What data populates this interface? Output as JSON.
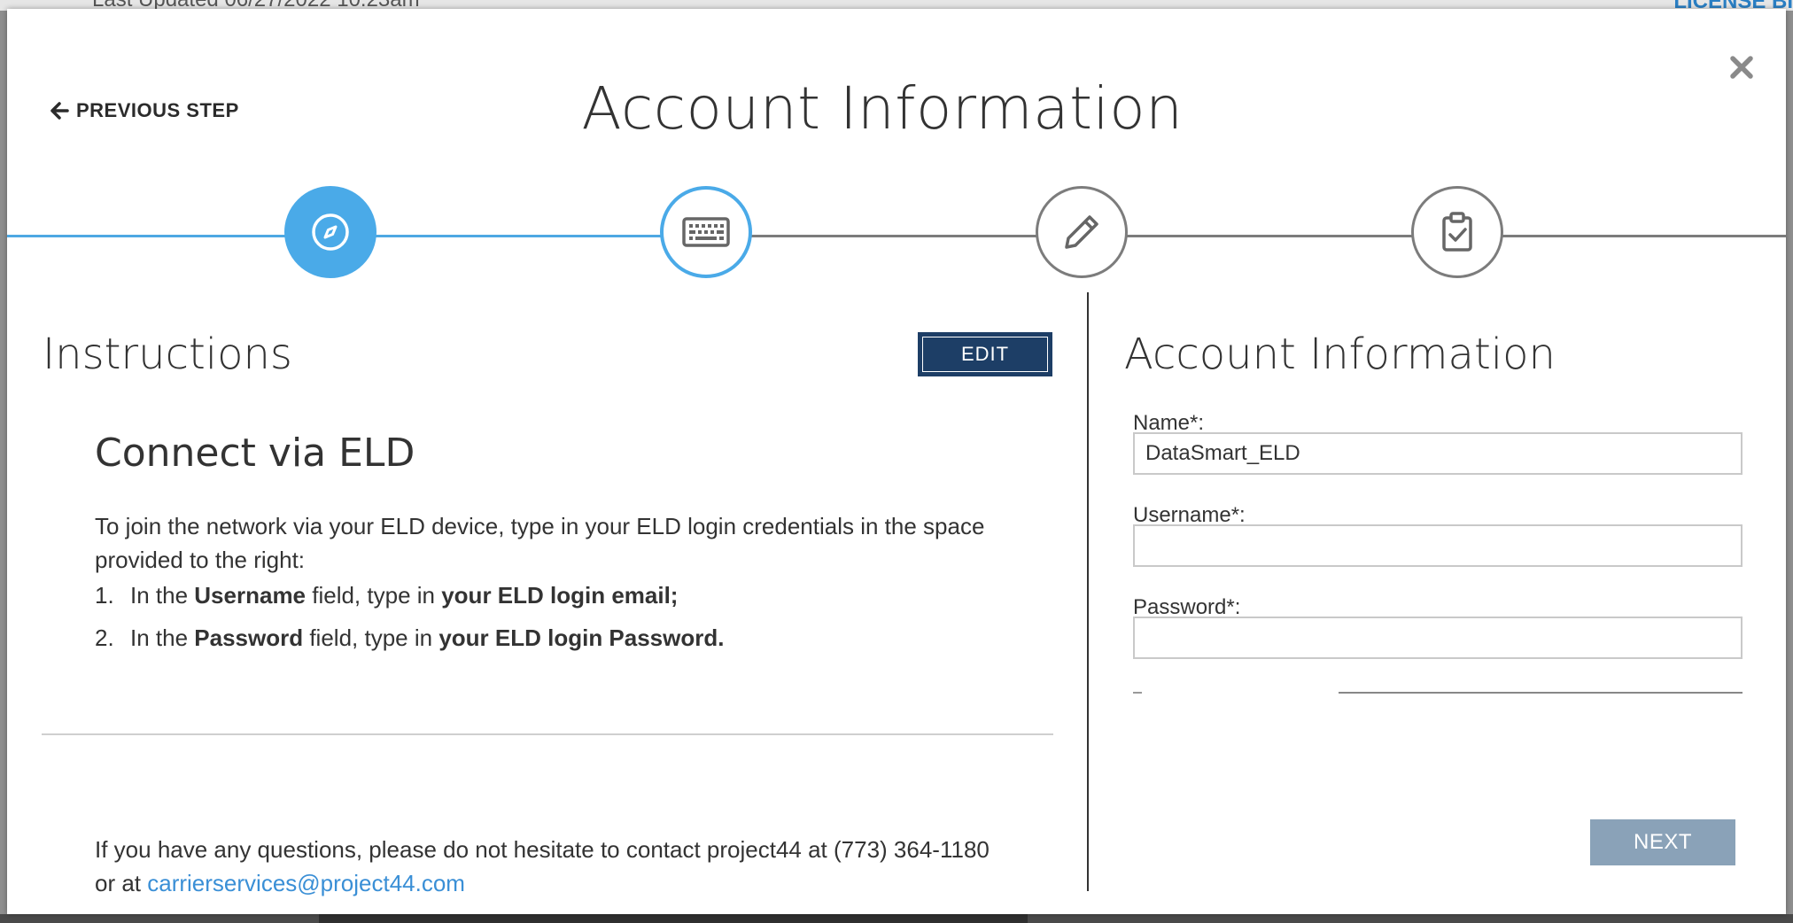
{
  "background": {
    "last_updated": "Last Updated 06/27/2022 10:23am",
    "license_link": "LICENSE BI"
  },
  "modal": {
    "title": "Account Information",
    "previous_step_label": "PREVIOUS STEP",
    "close_icon": "close-icon"
  },
  "stepper": {
    "steps": [
      {
        "icon": "compass-icon",
        "state": "complete"
      },
      {
        "icon": "keyboard-icon",
        "state": "current"
      },
      {
        "icon": "pencil-icon",
        "state": "pending"
      },
      {
        "icon": "clipboard-check-icon",
        "state": "pending"
      }
    ],
    "colors": {
      "active": "#4aaae8",
      "pending": "#7c7c7c"
    }
  },
  "instructions": {
    "title": "Instructions",
    "edit_label": "EDIT",
    "connect_title": "Connect via ELD",
    "intro": "To join the network via your ELD device, type in your ELD login credentials in the space provided to the right:",
    "steps": [
      {
        "num": "1.",
        "pre": "In the ",
        "field": "Username",
        "mid": " field, type in ",
        "value": "your ELD login email;"
      },
      {
        "num": "2.",
        "pre": "In the ",
        "field": "Password",
        "mid": " field, type in ",
        "value": "your ELD login Password."
      }
    ],
    "contact_text": "If you have any questions, please do not hesitate to contact project44 at (773) 364-1180 or at ",
    "contact_email": "carrierservices@project44.com"
  },
  "account_form": {
    "title": "Account Information",
    "name_label": "Name*:",
    "name_value": "DataSmart_ELD",
    "username_label": "Username*:",
    "username_value": "",
    "password_label": "Password*:",
    "password_value": "",
    "next_label": "NEXT"
  }
}
